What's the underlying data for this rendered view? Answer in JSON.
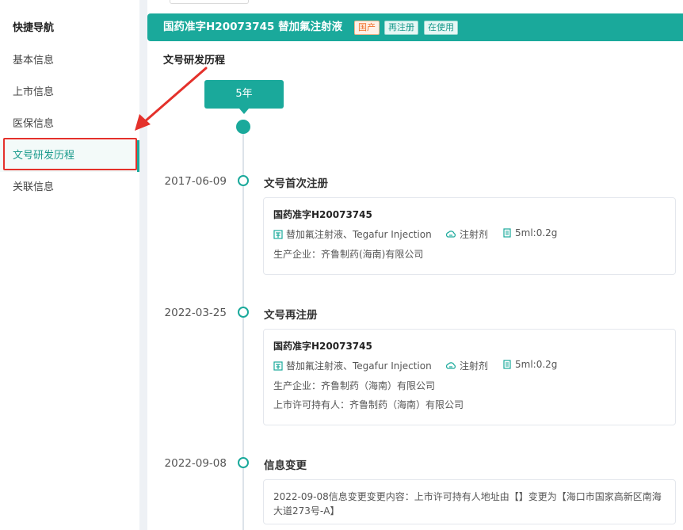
{
  "sidebar": {
    "title": "快捷导航",
    "items": [
      {
        "label": "基本信息"
      },
      {
        "label": "上市信息"
      },
      {
        "label": "医保信息"
      },
      {
        "label": "文号研发历程"
      },
      {
        "label": "关联信息"
      }
    ],
    "active_index": 3
  },
  "header": {
    "title": "国药准字H20073745   替加氟注射液",
    "tags": [
      "国产",
      "再注册",
      "在使用"
    ]
  },
  "section": {
    "title": "文号研发历程",
    "year_label": "5年"
  },
  "events": [
    {
      "date": "2017-06-09",
      "title": "文号首次注册",
      "card": {
        "approval": "国药准字H20073745",
        "drug": "替加氟注射液、Tegafur Injection",
        "form": "注射剂",
        "spec": "5ml:0.2g",
        "manufacturer": "生产企业：齐鲁制药(海南)有限公司"
      }
    },
    {
      "date": "2022-03-25",
      "title": "文号再注册",
      "card": {
        "approval": "国药准字H20073745",
        "drug": "替加氟注射液、Tegafur Injection",
        "form": "注射剂",
        "spec": "5ml:0.2g",
        "manufacturer": "生产企业：齐鲁制药（海南）有限公司",
        "holder": "上市许可持有人：齐鲁制药（海南）有限公司"
      }
    },
    {
      "date": "2022-09-08",
      "title": "信息变更",
      "card": {
        "content": "2022-09-08信息变更变更内容：上市许可持有人地址由【】变更为【海口市国家高新区南海大道273号-A】"
      }
    }
  ],
  "colors": {
    "accent": "#1aa99b",
    "annotation": "#e4312b",
    "tag_orange": "#f0702a"
  },
  "icons": [
    "drug-icon",
    "dosage-form-icon",
    "spec-icon"
  ]
}
